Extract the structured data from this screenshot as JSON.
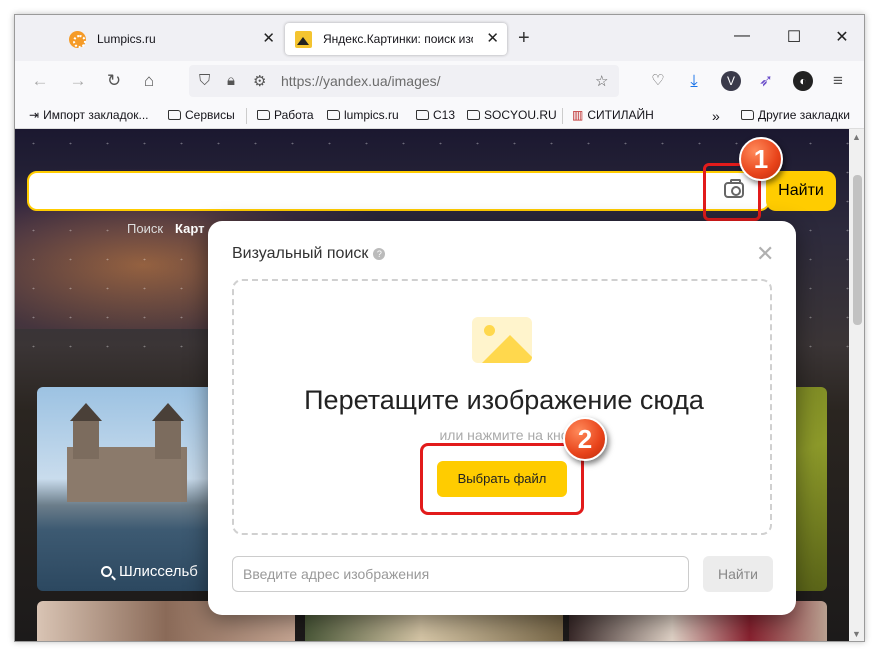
{
  "browser": {
    "tabs": [
      {
        "title": "Lumpics.ru"
      },
      {
        "title": "Яндекс.Картинки: поиск изобр"
      }
    ],
    "new_tab": "+",
    "window_controls": {
      "minimize": "—",
      "maximize": "☐",
      "close": "✕"
    },
    "url": "https://yandex.ua/images/",
    "extension_v": "V",
    "menu": "≡"
  },
  "bookmarks": [
    "Импорт закладок...",
    "Сервисы",
    "Работа",
    "lumpics.ru",
    "C13",
    "SOCYOU.RU",
    "СИТИЛАЙН",
    "Другие закладки"
  ],
  "page": {
    "search_button": "Найти",
    "nav_search": "Поиск",
    "nav_images": "Карт",
    "tile_caption": "Шлиссельб"
  },
  "modal": {
    "title": "Визуальный поиск",
    "help": "?",
    "close": "✕",
    "drop_title": "Перетащите изображение сюда",
    "drop_subtitle": "или нажмите на кно",
    "choose_button": "Выбрать файл",
    "url_placeholder": "Введите адрес изображения",
    "find_button": "Найти"
  },
  "markers": [
    "1",
    "2"
  ],
  "colors": {
    "accent": "#ffcc00",
    "highlight": "#e21b1b",
    "marker": "#e8431a"
  }
}
